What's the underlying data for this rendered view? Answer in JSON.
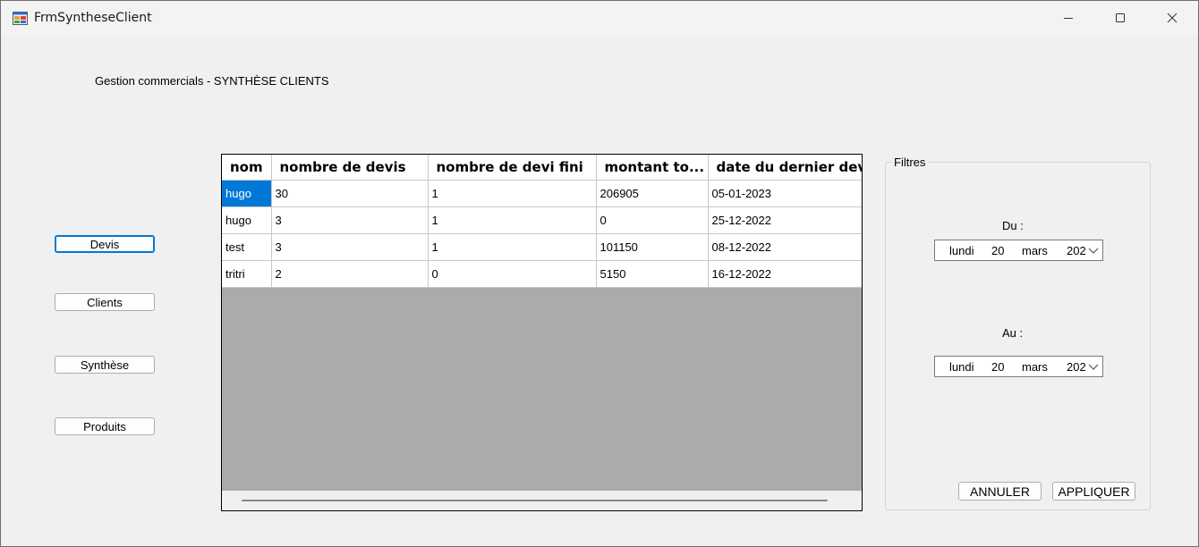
{
  "window": {
    "title": "FrmSyntheseClient"
  },
  "form": {
    "heading": "Gestion commercials - SYNTHÈSE CLIENTS"
  },
  "nav": {
    "devis": "Devis",
    "clients": "Clients",
    "synthese": "Synthèse",
    "produits": "Produits"
  },
  "grid": {
    "columns": [
      "nom",
      "nombre de devis",
      "nombre de devi fini",
      "montant to...",
      "date du dernier dev"
    ],
    "rows": [
      [
        "hugo",
        "30",
        "1",
        "206905",
        "05-01-2023"
      ],
      [
        "hugo",
        "3",
        "1",
        "0",
        "25-12-2022"
      ],
      [
        "test",
        "3",
        "1",
        "101150",
        "08-12-2022"
      ],
      [
        "tritri",
        "2",
        "0",
        "5150",
        "16-12-2022"
      ]
    ]
  },
  "filters": {
    "title": "Filtres",
    "du_label": "Du :",
    "au_label": "Au :",
    "du_date": {
      "day_name": "lundi",
      "day": "20",
      "month": "mars",
      "year": "202"
    },
    "au_date": {
      "day_name": "lundi",
      "day": "20",
      "month": "mars",
      "year": "202"
    },
    "cancel_label": "ANNULER",
    "apply_label": "APPLIQUER"
  },
  "icons": {
    "app": "app-form-icon",
    "minimize": "minimize-icon",
    "maximize": "maximize-icon",
    "close": "close-icon",
    "dropdown": "chevron-down-icon"
  },
  "colors": {
    "selection": "#0078d7",
    "focus_border": "#0078d4",
    "grid_background": "#ababab"
  }
}
